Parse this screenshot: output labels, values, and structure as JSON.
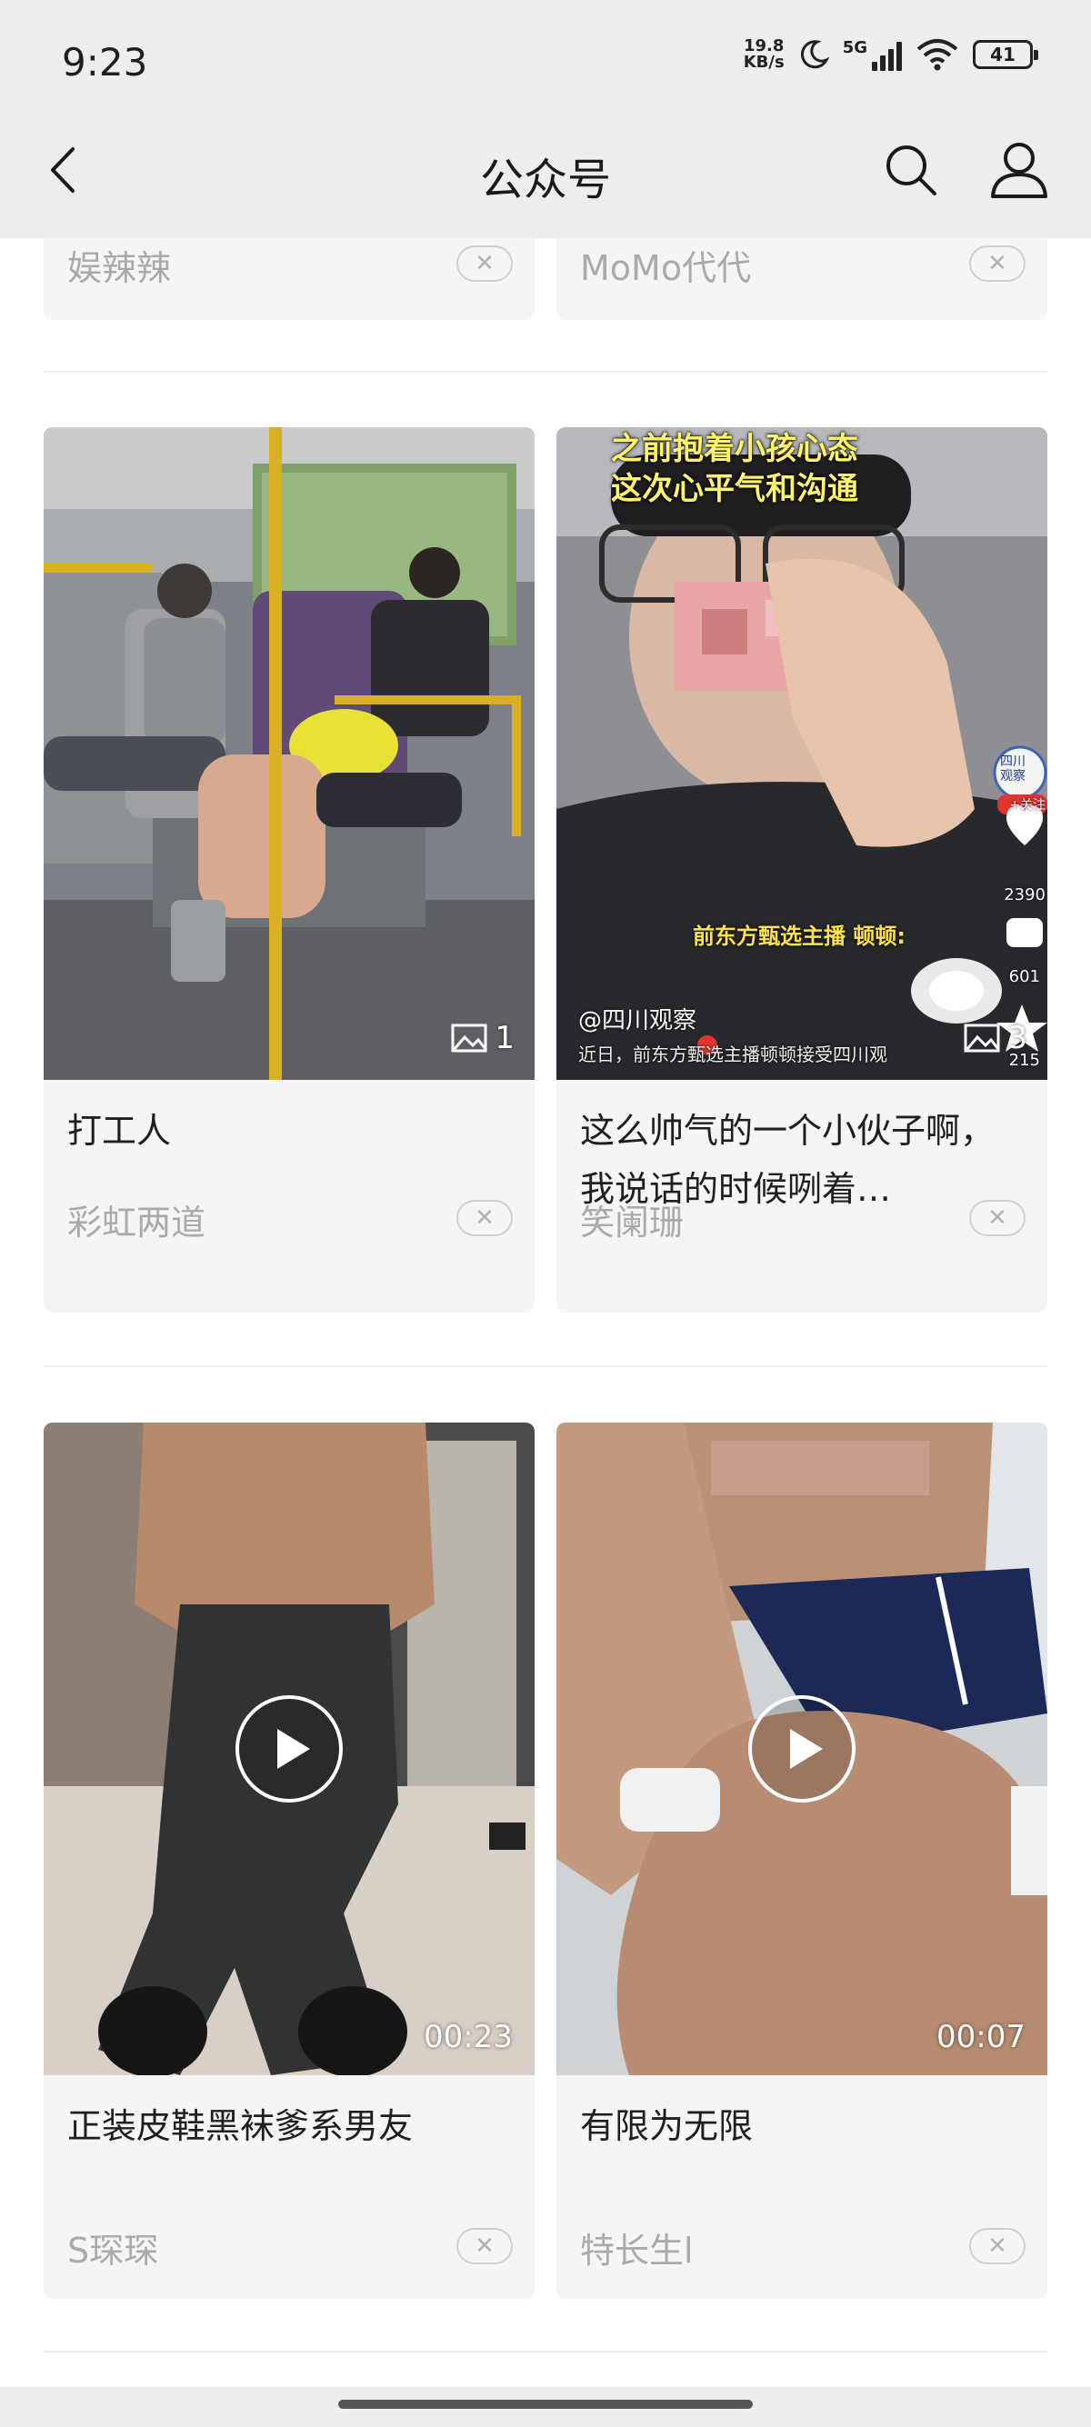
{
  "status_bar": {
    "time": "9:23",
    "net_speed_value": "19.8",
    "net_speed_unit": "KB/s",
    "network": "5G",
    "battery": "41"
  },
  "header": {
    "title": "公众号"
  },
  "cards": [
    {
      "title": "",
      "author": "娱辣辣",
      "dismiss": "✕"
    },
    {
      "title": "",
      "author": "MoMo代代",
      "dismiss": "✕"
    },
    {
      "title": "打工人",
      "author": "彩虹两道",
      "image_count": "1",
      "dismiss": "✕"
    },
    {
      "title": "这么帅气的一个小伙子啊，我说话的时候咧着…",
      "author": "笑阑珊",
      "image_count": "3",
      "dismiss": "✕",
      "overlay": {
        "caption_line1": "之前抱着小孩心态",
        "caption_line2": "这次心平气和沟通",
        "mid_caption": "前东方甄选主播 顿顿:",
        "handle": "@四川观察",
        "subline": "近日，前东方甄选主播顿顿接受四川观",
        "side_badge": "四川观察",
        "follow": "+关注",
        "likes": "2390",
        "comments": "601",
        "shares": "215"
      }
    },
    {
      "title": "正装皮鞋黑袜爹系男友",
      "author": "S琛琛",
      "duration": "00:23",
      "dismiss": "✕"
    },
    {
      "title": "有限为无限",
      "author": "特长生l",
      "duration": "00:07",
      "dismiss": "✕"
    }
  ]
}
